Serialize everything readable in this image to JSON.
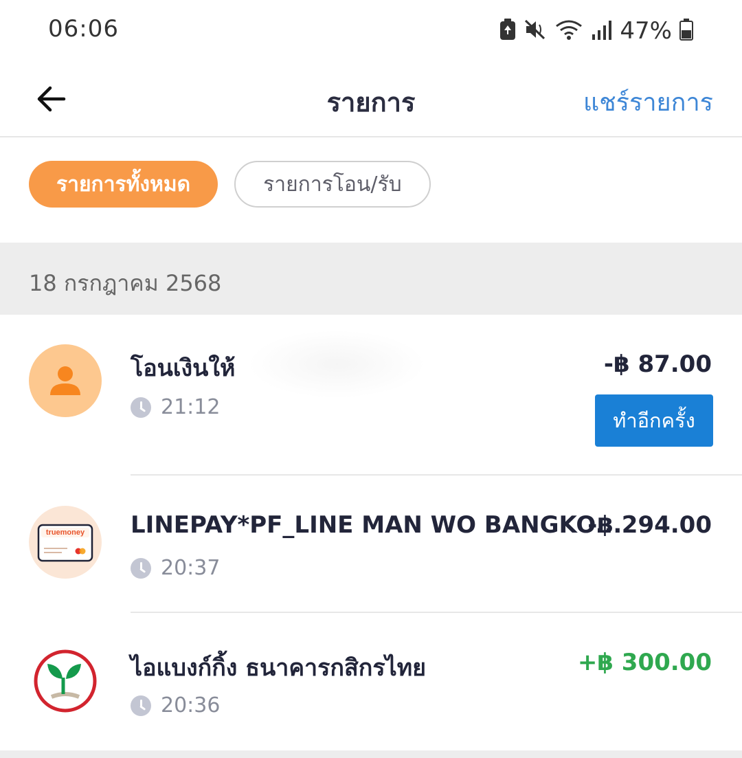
{
  "status_bar": {
    "time": "06:06",
    "battery_percent": "47%"
  },
  "header": {
    "title": "รายการ",
    "share_label": "แชร์รายการ"
  },
  "filters": {
    "all_label": "รายการทั้งหมด",
    "transfer_label": "รายการโอน/รับ"
  },
  "date_group": {
    "label": "18 กรกฎาคม 2568"
  },
  "transactions": [
    {
      "title": "โอนเงินให้",
      "time": "21:12",
      "amount": "-฿ 87.00",
      "action_label": "ทำอีกครั้ง",
      "icon": "person-icon"
    },
    {
      "title": "LINEPAY*PF_LINE MAN WO BANGKO...",
      "time": "20:37",
      "amount": "-฿ 294.00",
      "icon": "truemoney-card-icon",
      "icon_text": "truemoney"
    },
    {
      "title": "ไอแบงก์กิ้ง  ธนาคารกสิกรไทย",
      "time": "20:36",
      "amount": "+฿ 300.00",
      "icon": "kasikorn-bank-logo"
    }
  ],
  "colors": {
    "accent_orange": "#f89a48",
    "link_blue": "#3d86d6",
    "button_blue": "#1a80d6",
    "positive_green": "#2fa84f"
  }
}
